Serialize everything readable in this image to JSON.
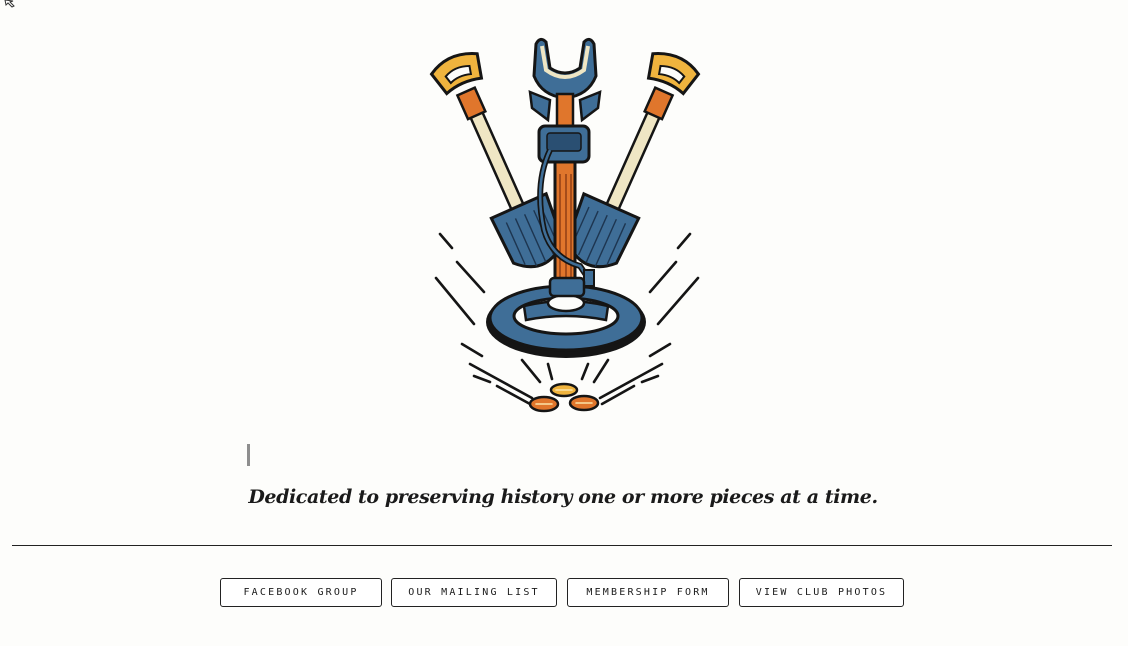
{
  "logo": {
    "icon": "metal-detector-shovels-coins-icon",
    "colors": {
      "outline": "#151515",
      "blue": "#3f6e97",
      "orange": "#e0762c",
      "yellow": "#f0b43e",
      "cream": "#efe6c4"
    }
  },
  "tagline": "Dedicated to preserving history one or more pieces at a time.",
  "links": [
    {
      "label": "FACEBOOK GROUP"
    },
    {
      "label": "OUR MAILING LIST"
    },
    {
      "label": "MEMBERSHIP FORM"
    },
    {
      "label": "VIEW CLUB PHOTOS"
    }
  ]
}
